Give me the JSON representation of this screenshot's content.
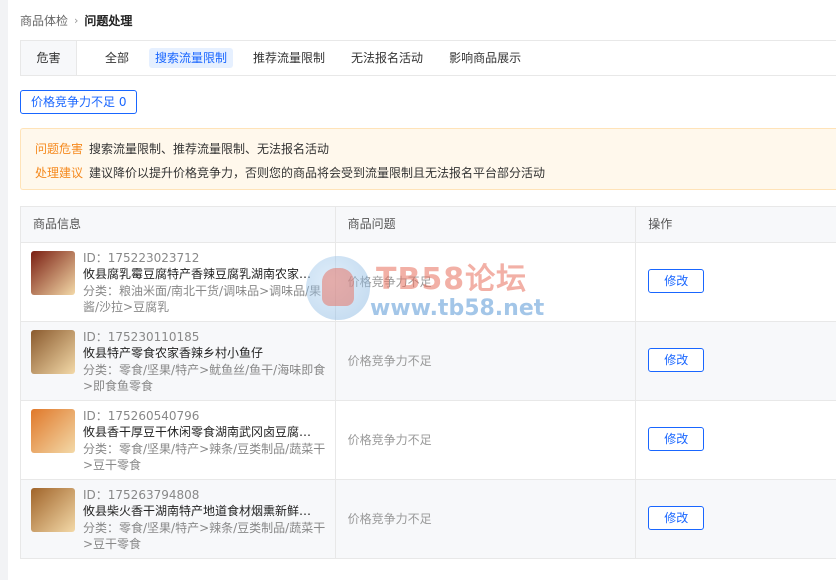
{
  "breadcrumb": {
    "parent": "商品体检",
    "separator": "›",
    "current": "问题处理"
  },
  "tabs": {
    "label": "危害",
    "items": [
      {
        "label": "全部",
        "active": false
      },
      {
        "label": "搜索流量限制",
        "active": true
      },
      {
        "label": "推荐流量限制",
        "active": false
      },
      {
        "label": "无法报名活动",
        "active": false
      },
      {
        "label": "影响商品展示",
        "active": false
      }
    ]
  },
  "filter_button": {
    "label": "价格竞争力不足 0"
  },
  "notice": {
    "harm_key": "问题危害",
    "harm_value": "搜索流量限制、推荐流量限制、无法报名活动",
    "advice_key": "处理建议",
    "advice_value": "建议降价以提升价格竞争力，否则您的商品将会受到流量限制且无法报名平台部分活动"
  },
  "table": {
    "headers": {
      "product": "商品信息",
      "problem": "商品问题",
      "action": "操作"
    },
    "rows": [
      {
        "id": "ID：175223023712",
        "name": "攸县腐乳霉豆腐特产香辣豆腐乳湖南农家特辣麻...",
        "category": "分类：粮油米面/南北干货/调味品>调味品/果酱/沙拉>豆腐乳",
        "problem": "价格竞争力不足",
        "action": "修改",
        "thumb_color": "#7a1e12"
      },
      {
        "id": "ID：175230110185",
        "name": "攸县特产零食农家香辣乡村小鱼仔",
        "category": "分类：零食/坚果/特产>鱿鱼丝/鱼干/海味即食>即食鱼零食",
        "problem": "价格竞争力不足",
        "action": "修改",
        "thumb_color": "#8a5a2e"
      },
      {
        "id": "ID：175260540796",
        "name": "攸县香干厚豆干休闲零食湖南武冈卤豆腐干小包...",
        "category": "分类：零食/坚果/特产>辣条/豆类制品/蔬菜干>豆干零食",
        "problem": "价格竞争力不足",
        "action": "修改",
        "thumb_color": "#e0782a"
      },
      {
        "id": "ID：175263794808",
        "name": "攸县柴火香干湖南特产地道食材烟熏新鲜豆腐非...",
        "category": "分类：零食/坚果/特产>辣条/豆类制品/蔬菜干>豆干零食",
        "problem": "价格竞争力不足",
        "action": "修改",
        "thumb_color": "#a0642a"
      }
    ]
  },
  "watermark": {
    "title": "TB58论坛",
    "url": "www.tb58.net"
  }
}
